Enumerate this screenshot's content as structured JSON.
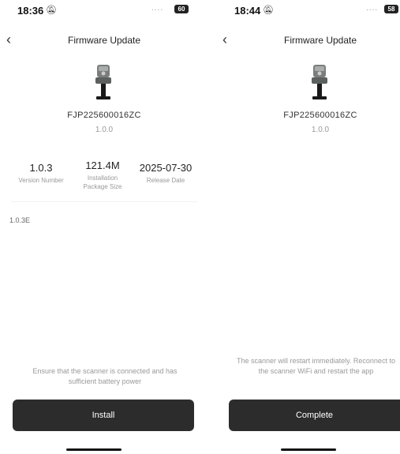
{
  "left": {
    "status": {
      "time": "18:36",
      "signal": "....",
      "battery": "60"
    },
    "nav": {
      "title": "Firmware Update"
    },
    "device": {
      "name": "FJP225600016ZC",
      "version": "1.0.0"
    },
    "info": [
      {
        "value": "1.0.3",
        "label": "Version Number"
      },
      {
        "value": "121.4M",
        "label": "Installation Package Size"
      },
      {
        "value": "2025-07-30",
        "label": "Release Date"
      }
    ],
    "notes": "1.0.3E",
    "hint": "Ensure that the scanner is connected and has sufficient battery power",
    "button_label": "Install"
  },
  "right": {
    "status": {
      "time": "18:44",
      "signal": "....",
      "battery": "58"
    },
    "nav": {
      "title": "Firmware Update"
    },
    "device": {
      "name": "FJP225600016ZC",
      "version": "1.0.0"
    },
    "hint": "The scanner will restart immediately. Reconnect to the scanner WiFi and restart the app",
    "button_label": "Complete"
  },
  "icons": {
    "back": "chevron-left-icon",
    "mute": "bell-muted-icon",
    "battery": "battery-icon"
  },
  "colors": {
    "button_bg": "#2c2c2c",
    "button_text": "#ffffff",
    "muted_text": "#999999"
  }
}
